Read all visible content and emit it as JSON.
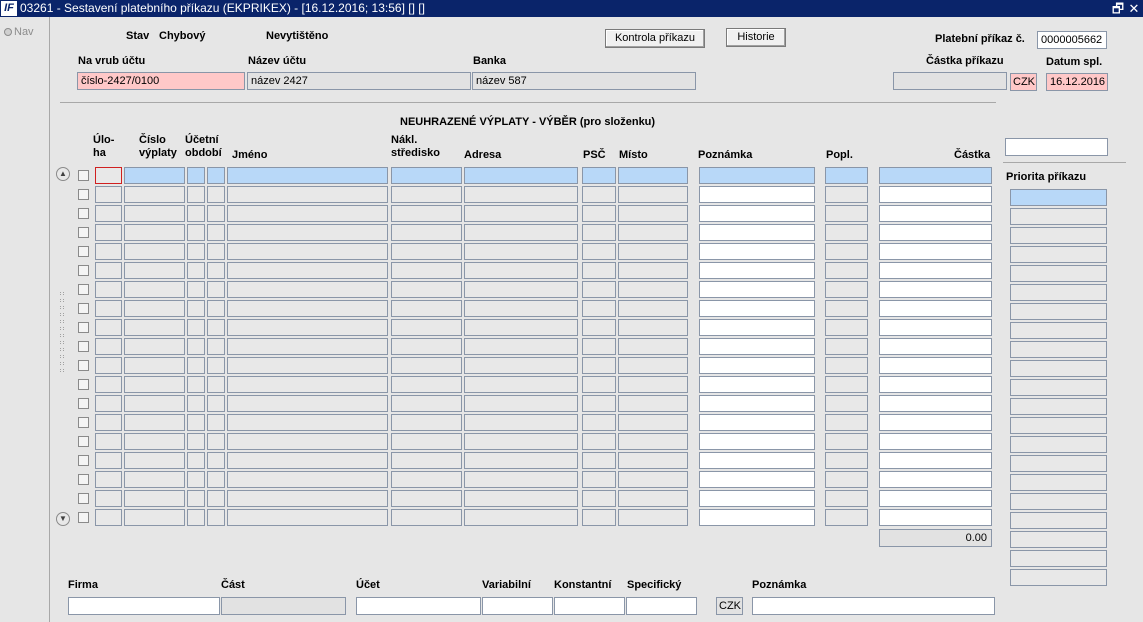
{
  "window": {
    "title": "03261 - Sestavení platebního příkazu (EKPRIKEX) - [16.12.2016; 13:56]  [] []",
    "logo": "IF",
    "restore_glyph": "🗗",
    "close_glyph": "✕"
  },
  "nav": {
    "label": "Nav"
  },
  "header": {
    "stav_label": "Stav",
    "stav_value": "Chybový",
    "print_status": "Nevytištěno",
    "kontrola_button": "Kontrola příkazu",
    "historie_button": "Historie",
    "platebni_prikaz_label": "Platební příkaz č.",
    "platebni_prikaz_value": "0000005662"
  },
  "account": {
    "na_vrub_label": "Na vrub účtu",
    "na_vrub_value": "číslo-2427/0100",
    "nazev_label": "Název účtu",
    "nazev_value": "název 2427",
    "banka_label": "Banka",
    "banka_value": "název 587",
    "castka_label": "Částka příkazu",
    "castka_value": "",
    "currency": "CZK",
    "datum_label": "Datum spl.",
    "datum_value": "16.12.2016"
  },
  "grid": {
    "title": "NEUHRAZENÉ VÝPLATY - VÝBĚR (pro složenku)",
    "columns": {
      "uloha": "Úlo-\nha",
      "cislo": "Číslo\nvýplaty",
      "obdobi": "Účetní\nobdobí",
      "jmeno": "Jméno",
      "stredisko": "Nákl.\nstředisko",
      "adresa": "Adresa",
      "psc": "PSČ",
      "misto": "Místo",
      "poznamka": "Poznámka",
      "popl": "Popl.",
      "castka": "Částka"
    },
    "row_count": 19,
    "total": "0.00",
    "scroll_up": "▲",
    "scroll_down": "▼"
  },
  "right_panel": {
    "priorita_label": "Priorita příkazu"
  },
  "footer": {
    "firma_label": "Firma",
    "firma_value": "",
    "cast_label": "Část",
    "ucet_label": "Účet",
    "variabilni_label": "Variabilní",
    "konstantni_label": "Konstantní",
    "specificky_label": "Specifický",
    "currency": "CZK",
    "poznamka_label": "Poznámka"
  }
}
